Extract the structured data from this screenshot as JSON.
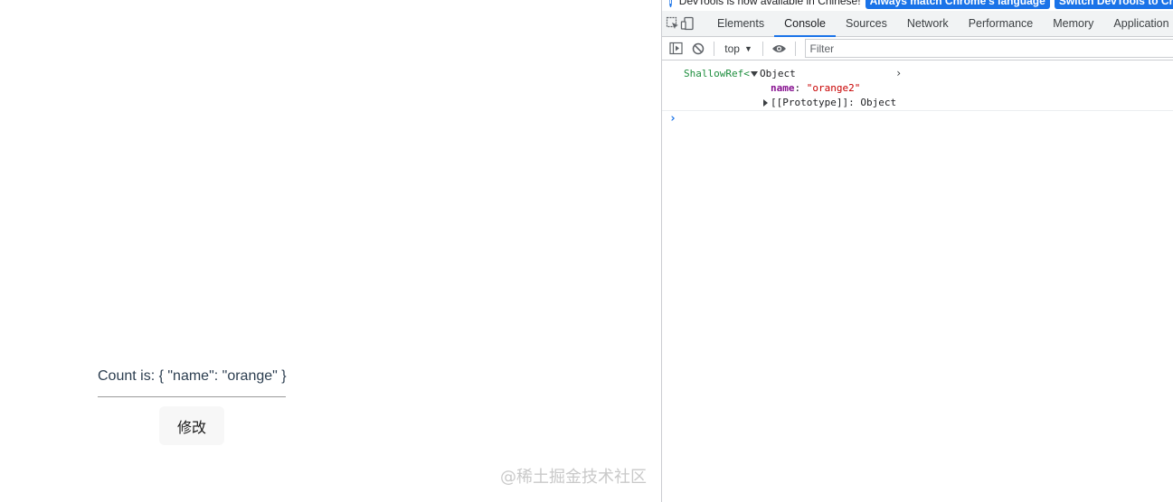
{
  "page": {
    "count_text": "Count is: { \"name\": \"orange\" }",
    "modify_button_label": "修改",
    "watermark": "@稀土掘金技术社区"
  },
  "devtools": {
    "infobar": {
      "message": "DevTools is now available in Chinese!",
      "always_match_button": "Always match Chrome's language",
      "switch_button": "Switch DevTools to Chinese"
    },
    "tabs": [
      {
        "label": "Elements",
        "active": false
      },
      {
        "label": "Console",
        "active": true
      },
      {
        "label": "Sources",
        "active": false
      },
      {
        "label": "Network",
        "active": false
      },
      {
        "label": "Performance",
        "active": false
      },
      {
        "label": "Memory",
        "active": false
      },
      {
        "label": "Application",
        "active": false
      }
    ],
    "toolbar": {
      "context": "top",
      "filter_placeholder": "Filter"
    },
    "console": {
      "entry": {
        "prefix": "ShallowRef<",
        "object_label": "Object",
        "property_key": "name",
        "property_value": "\"orange2\"",
        "proto_label": "[[Prototype]]: Object"
      },
      "prompt": "›"
    },
    "colors": {
      "accent": "#1a73e8",
      "prefix_green": "#1e8e3e",
      "key_purple": "#881391",
      "string_red": "#c80000"
    }
  }
}
